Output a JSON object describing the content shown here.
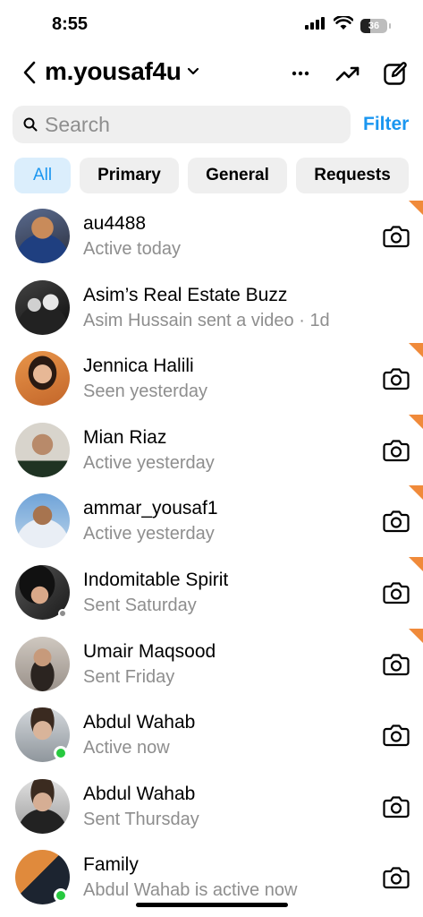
{
  "status": {
    "time": "8:55",
    "battery": "36",
    "battery_level": 0.36
  },
  "header": {
    "username": "m.yousaf4u"
  },
  "search": {
    "placeholder": "Search",
    "value": "",
    "filter_label": "Filter"
  },
  "tabs": [
    {
      "label": "All",
      "active": true
    },
    {
      "label": "Primary",
      "active": false
    },
    {
      "label": "General",
      "active": false
    },
    {
      "label": "Requests",
      "active": false
    }
  ],
  "colors": {
    "accent": "#1a96f0",
    "unread_flag": "#f08a3a",
    "online": "#27c93f",
    "muted": "#8e8e8e"
  },
  "conversations": [
    {
      "name": "au4488",
      "subtitle": "Active today",
      "camera": true,
      "flag": true,
      "online": false
    },
    {
      "name": "Asim’s Real Estate Buzz",
      "subtitle": "Asim Hussain sent a video · 1d",
      "camera": false,
      "flag": false,
      "online": false
    },
    {
      "name": "Jennica Halili",
      "subtitle": "Seen yesterday",
      "camera": true,
      "flag": true,
      "online": false
    },
    {
      "name": "Mian Riaz",
      "subtitle": "Active yesterday",
      "camera": true,
      "flag": true,
      "online": false
    },
    {
      "name": "ammar_yousaf1",
      "subtitle": "Active yesterday",
      "camera": true,
      "flag": true,
      "online": false
    },
    {
      "name": "Indomitable Spirit",
      "subtitle": "Sent Saturday",
      "camera": true,
      "flag": true,
      "online": false
    },
    {
      "name": "Umair Maqsood",
      "subtitle": "Sent Friday",
      "camera": true,
      "flag": true,
      "online": false
    },
    {
      "name": "Abdul Wahab",
      "subtitle": "Active now",
      "camera": true,
      "flag": false,
      "online": true
    },
    {
      "name": "Abdul Wahab",
      "subtitle": "Sent Thursday",
      "camera": true,
      "flag": false,
      "online": false
    },
    {
      "name": "Family",
      "subtitle": "Abdul Wahab is active now",
      "camera": true,
      "flag": false,
      "online": true
    }
  ]
}
